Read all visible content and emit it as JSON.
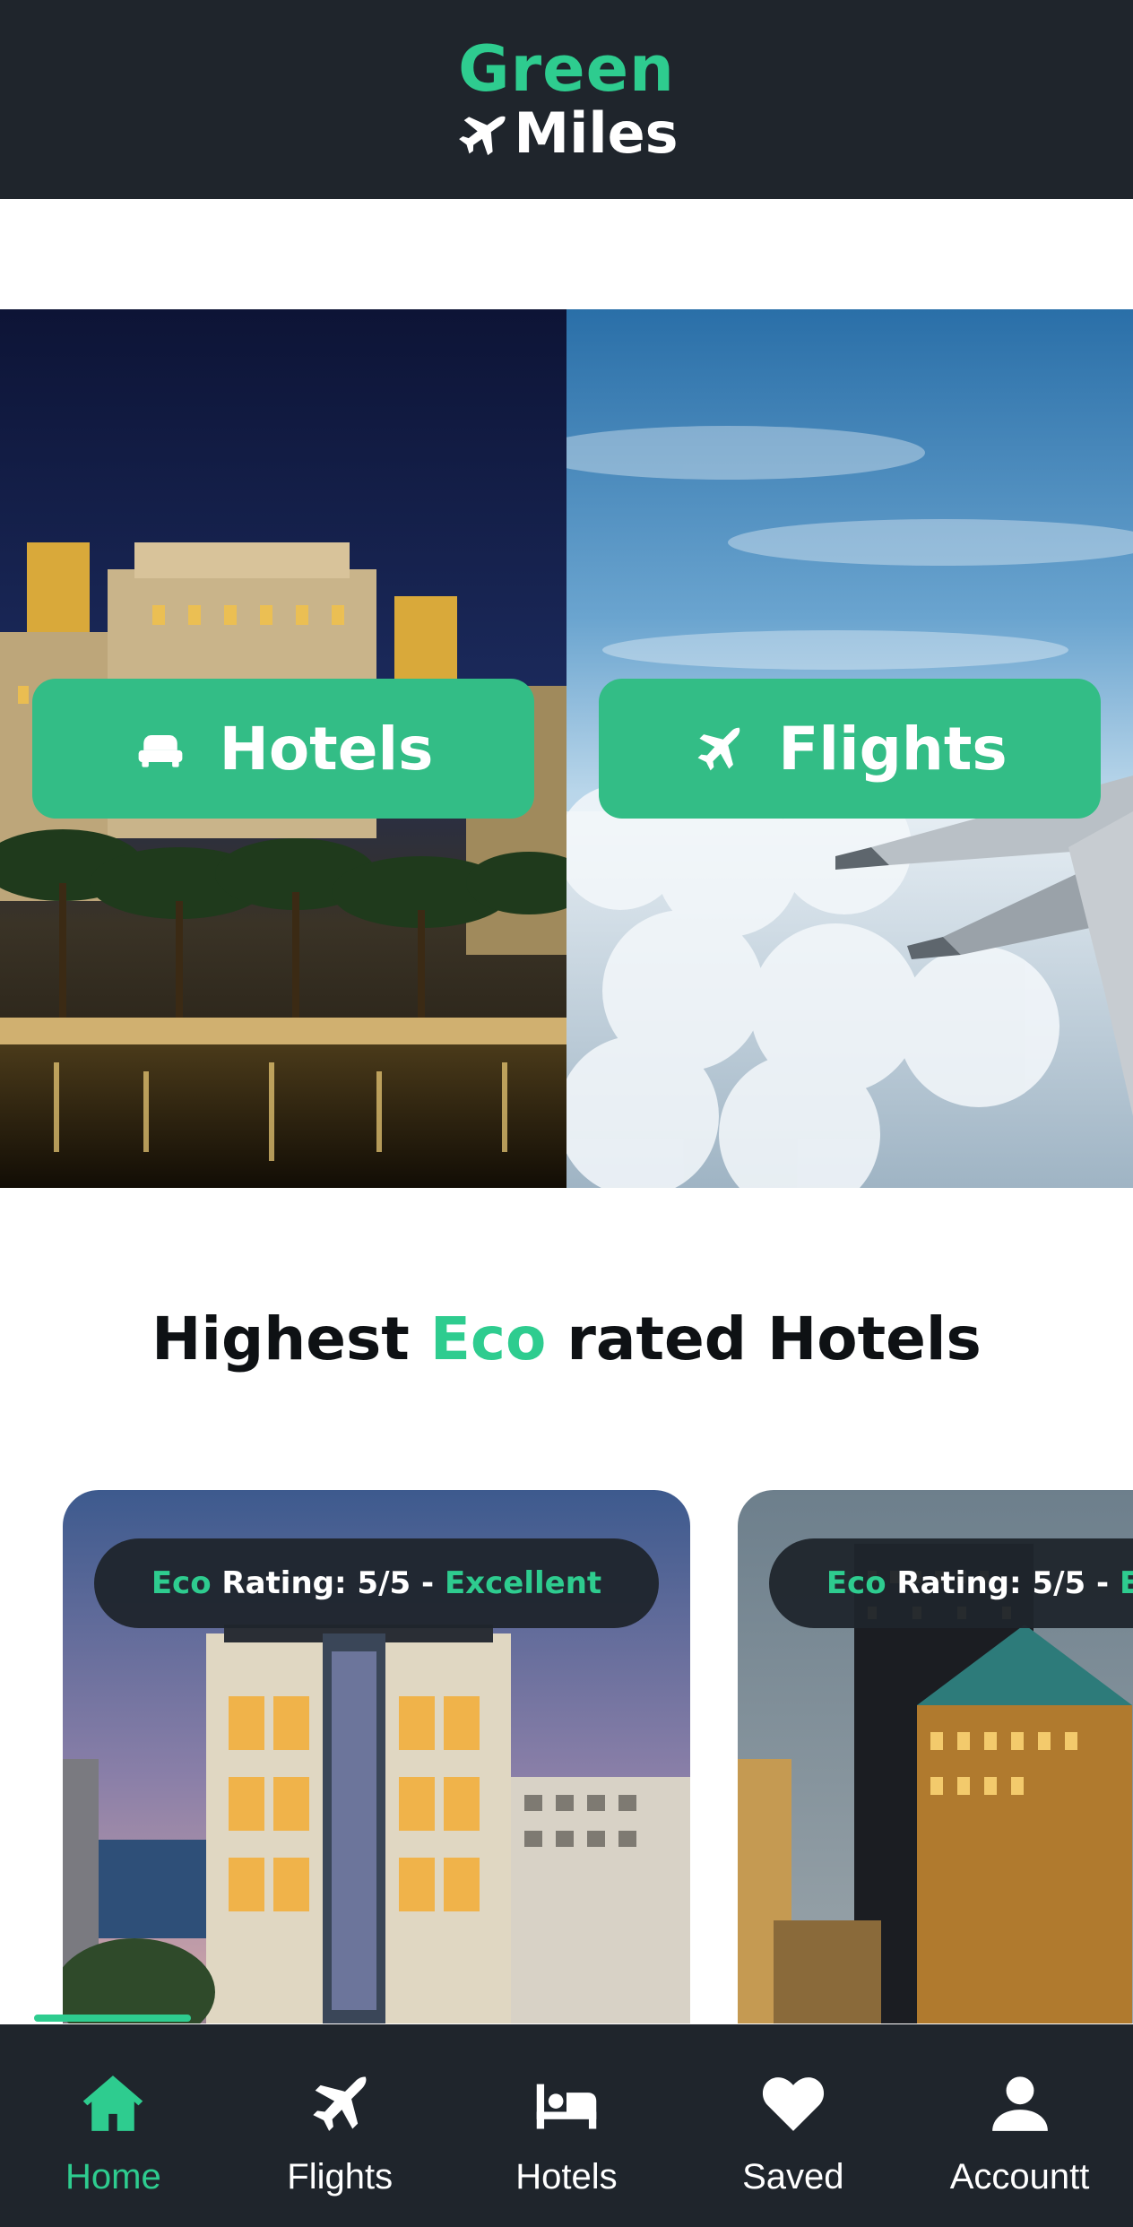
{
  "header": {
    "logo_line1": "Green",
    "logo_line2": "Miles",
    "logo_icon": "airplane-icon"
  },
  "hero": {
    "hotels_label": "Hotels",
    "hotels_icon": "bed-icon",
    "flights_label": "Flights",
    "flights_icon": "airplane-icon"
  },
  "section": {
    "title_prefix": "Highest ",
    "title_accent": "Eco",
    "title_suffix": " rated Hotels"
  },
  "hotels": [
    {
      "rating_eco": "Eco",
      "rating_text": " Rating: 5/5 - ",
      "rating_grade": "Excellent"
    },
    {
      "rating_eco": "Eco",
      "rating_text": " Rating: 5/5 - ",
      "rating_grade": "Excellent"
    }
  ],
  "nav": {
    "items": [
      {
        "label": "Home",
        "icon": "home-icon",
        "active": true
      },
      {
        "label": "Flights",
        "icon": "airplane-icon",
        "active": false
      },
      {
        "label": "Hotels",
        "icon": "bed-icon",
        "active": false
      },
      {
        "label": "Saved",
        "icon": "heart-icon",
        "active": false
      },
      {
        "label": "Accountt",
        "icon": "user-icon",
        "active": false
      }
    ]
  },
  "colors": {
    "brand_green": "#2ecc8f",
    "button_green": "#33bd86",
    "dark_bg": "#1f252c"
  }
}
